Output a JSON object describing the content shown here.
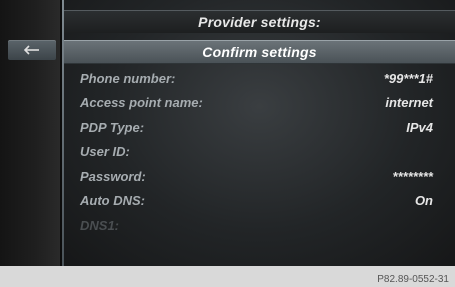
{
  "header": {
    "provider_title": "Provider settings:",
    "confirm_label": "Confirm settings"
  },
  "back_button": {
    "icon": "back-arrow-icon"
  },
  "settings": [
    {
      "label": "Phone number:",
      "value": "*99***1#"
    },
    {
      "label": "Access point name:",
      "value": "internet"
    },
    {
      "label": "PDP Type:",
      "value": "IPv4"
    },
    {
      "label": "User ID:",
      "value": ""
    },
    {
      "label": "Password:",
      "value": "********"
    },
    {
      "label": "Auto DNS:",
      "value": "On"
    },
    {
      "label": "DNS1:",
      "value": ""
    }
  ],
  "figure_code": "P82.89-0552-31",
  "colors": {
    "background": "#0c0c0c",
    "highlight_bar": "#5b646a",
    "label_text": "#a6acb0",
    "value_text": "#e6e6e6"
  }
}
